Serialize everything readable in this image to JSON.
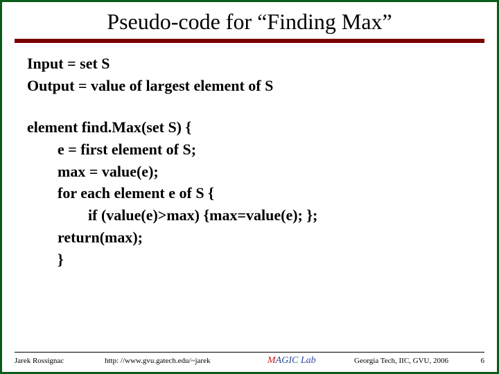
{
  "title": "Pseudo-code for “Finding Max”",
  "io": {
    "input": "Input = set S",
    "output": "Output = value of largest element of S"
  },
  "code": {
    "l0": "element find.Max(set S) {",
    "l1": "e = first element of S;",
    "l2": "max = value(e);",
    "l3": "for each element e of S {",
    "l4": "if (value(e)>max) {max=value(e); };",
    "l5": "return(max);",
    "l6": "}"
  },
  "footer": {
    "author": "Jarek Rossignac",
    "url": "http: //www.gvu.gatech.edu/~jarek",
    "lab_m": "M",
    "lab_rest": "AGIC Lab",
    "affil": "Georgia Tech, IIC, GVU, 2006",
    "page": "6"
  }
}
